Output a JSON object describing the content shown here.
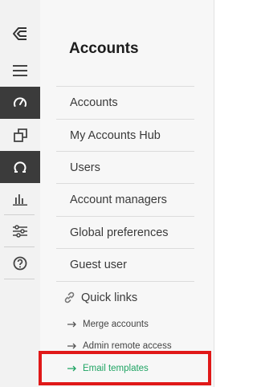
{
  "rail": {
    "items": [
      {
        "icon": "logo-icon"
      },
      {
        "icon": "menu-icon"
      },
      {
        "icon": "dashboard-gauge-icon"
      },
      {
        "icon": "copy-icon"
      },
      {
        "icon": "support-icon"
      },
      {
        "icon": "bar-chart-icon"
      },
      {
        "icon": "sliders-icon"
      },
      {
        "icon": "help-icon"
      }
    ],
    "active_colors": {
      "background": "#3b3b3b",
      "icon": "#ffffff"
    }
  },
  "panel": {
    "title": "Accounts",
    "items": [
      {
        "label": "Accounts"
      },
      {
        "label": "My Accounts Hub"
      },
      {
        "label": "Users"
      },
      {
        "label": "Account managers"
      },
      {
        "label": "Global preferences"
      },
      {
        "label": "Guest user"
      }
    ],
    "quick_links": {
      "label": "Quick links",
      "icon": "link-icon",
      "items": [
        {
          "label": "Merge accounts",
          "icon": "arrow-right-icon"
        },
        {
          "label": "Admin remote access",
          "icon": "arrow-right-icon"
        },
        {
          "label": "Email templates",
          "icon": "arrow-right-icon",
          "current": true
        }
      ]
    }
  },
  "colors": {
    "accent_green": "#1fa463",
    "highlight_red": "#e01818"
  }
}
